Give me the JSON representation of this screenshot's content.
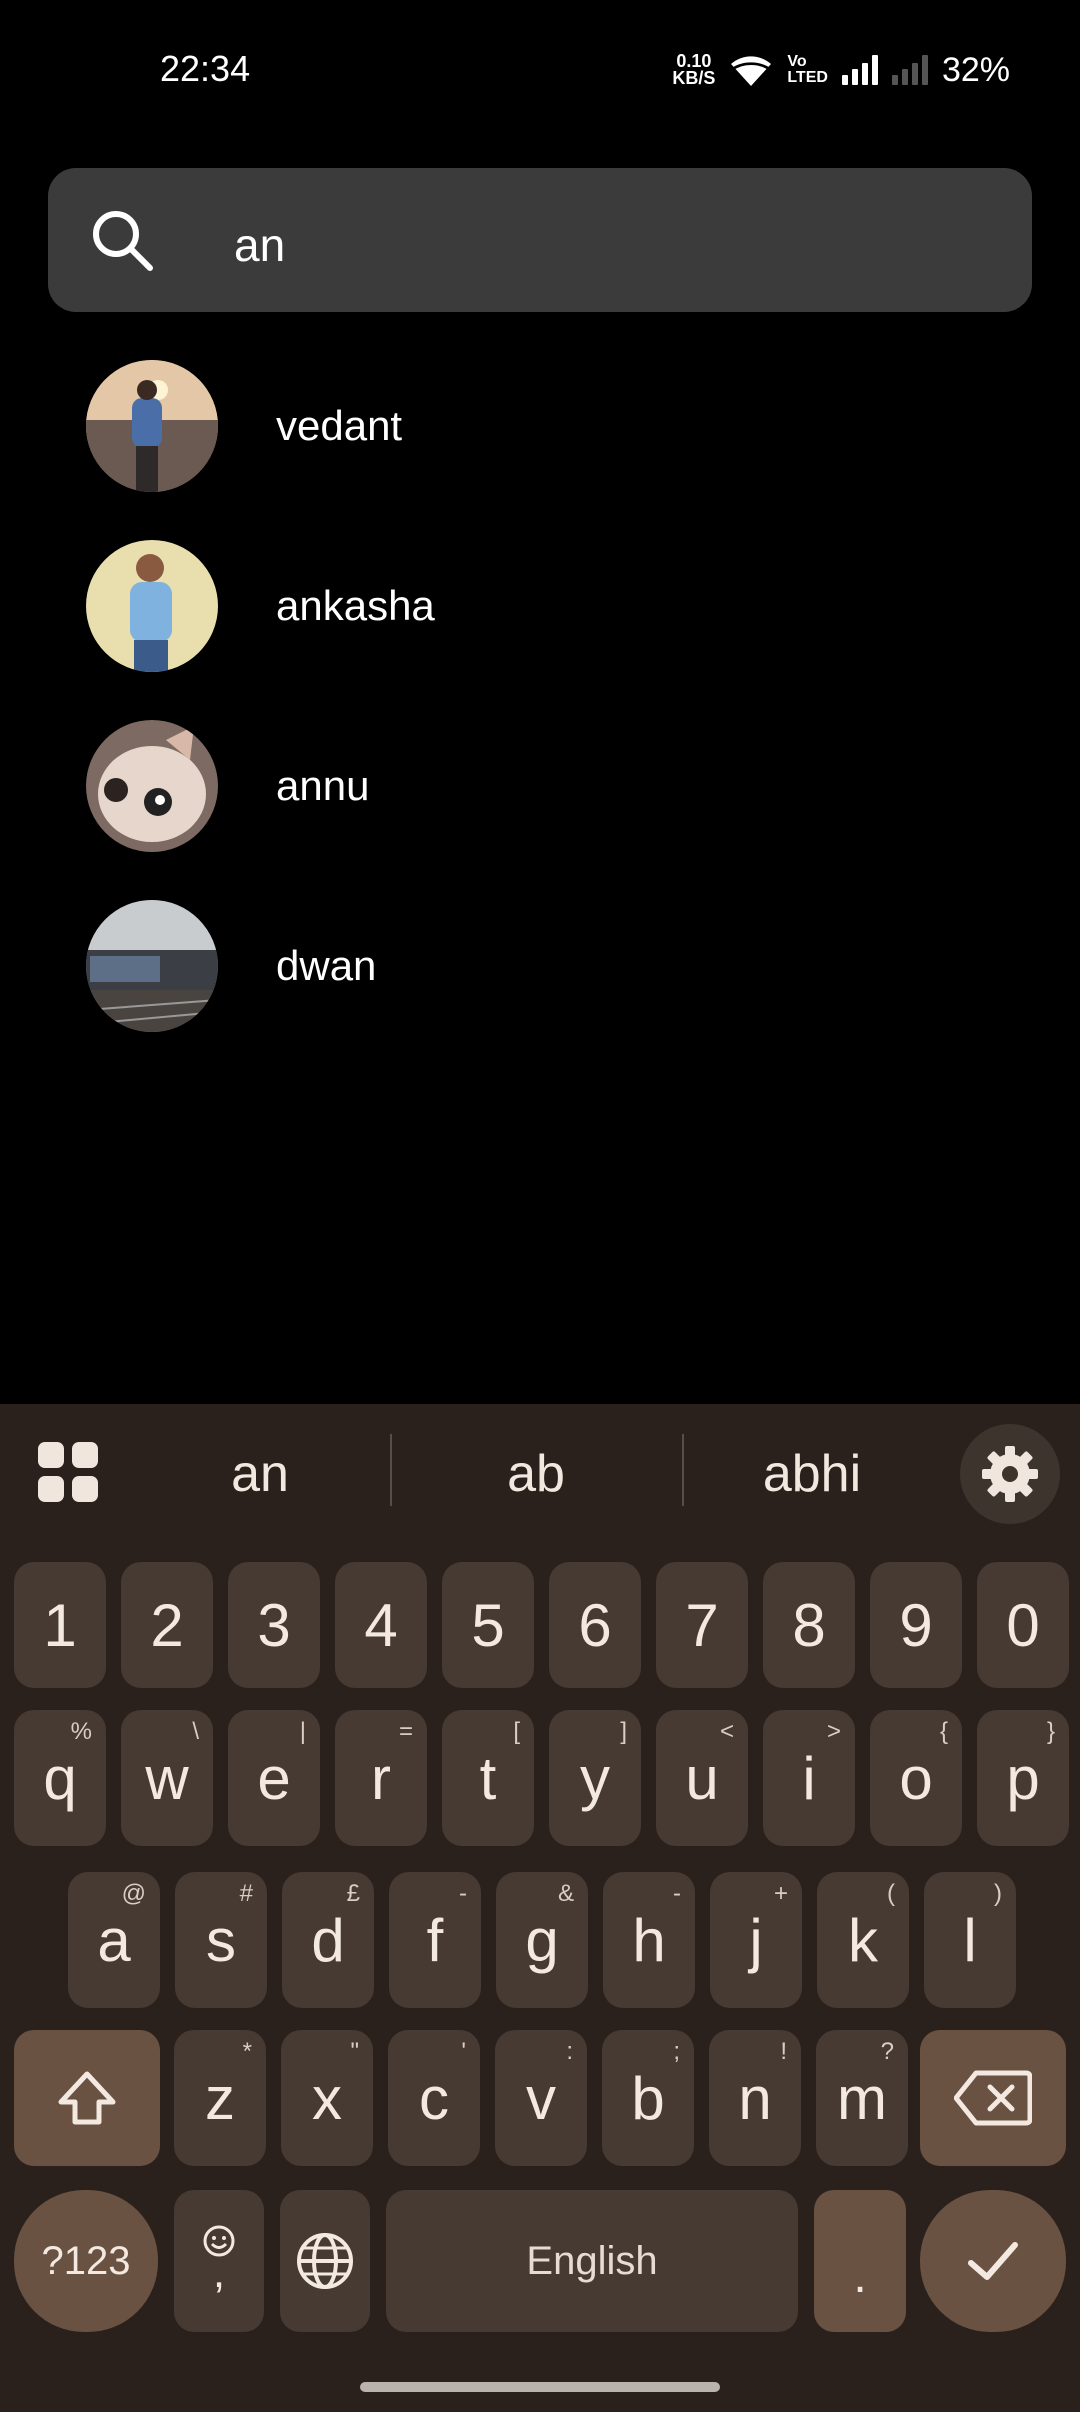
{
  "status_bar": {
    "time": "22:34",
    "net_speed_value": "0.10",
    "net_speed_unit": "KB/S",
    "volte": "Vo\nLTED",
    "battery": "32%"
  },
  "search": {
    "query": "an"
  },
  "results": [
    {
      "name": "vedant"
    },
    {
      "name": "ankasha"
    },
    {
      "name": "annu"
    },
    {
      "name": "dwan"
    }
  ],
  "keyboard": {
    "suggestions": [
      "an",
      "ab",
      "abhi"
    ],
    "number_row": [
      "1",
      "2",
      "3",
      "4",
      "5",
      "6",
      "7",
      "8",
      "9",
      "0"
    ],
    "row1": [
      {
        "k": "q",
        "h": "%"
      },
      {
        "k": "w",
        "h": "\\"
      },
      {
        "k": "e",
        "h": "|"
      },
      {
        "k": "r",
        "h": "="
      },
      {
        "k": "t",
        "h": "["
      },
      {
        "k": "y",
        "h": "]"
      },
      {
        "k": "u",
        "h": "<"
      },
      {
        "k": "i",
        "h": ">"
      },
      {
        "k": "o",
        "h": "{"
      },
      {
        "k": "p",
        "h": "}"
      }
    ],
    "row2": [
      {
        "k": "a",
        "h": "@"
      },
      {
        "k": "s",
        "h": "#"
      },
      {
        "k": "d",
        "h": "£"
      },
      {
        "k": "f",
        "h": "-"
      },
      {
        "k": "g",
        "h": "&"
      },
      {
        "k": "h",
        "h": "-"
      },
      {
        "k": "j",
        "h": "+"
      },
      {
        "k": "k",
        "h": "("
      },
      {
        "k": "l",
        "h": ")"
      }
    ],
    "row3": [
      {
        "k": "z",
        "h": "*"
      },
      {
        "k": "x",
        "h": "\""
      },
      {
        "k": "c",
        "h": "'"
      },
      {
        "k": "v",
        "h": ":"
      },
      {
        "k": "b",
        "h": ";"
      },
      {
        "k": "n",
        "h": "!"
      },
      {
        "k": "m",
        "h": "?"
      }
    ],
    "symbols_key": "?123",
    "comma": ",",
    "space": "English",
    "period": "."
  }
}
